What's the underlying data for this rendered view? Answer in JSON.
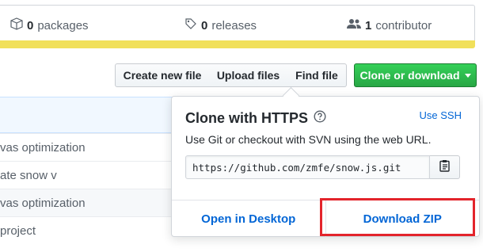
{
  "summary": {
    "packages_count": "0",
    "packages_label": "packages",
    "releases_count": "0",
    "releases_label": "releases",
    "contributors_count": "1",
    "contributors_label": "contributor",
    "language_bar_color": "#f1e05a"
  },
  "toolbar": {
    "create_label": "Create new file",
    "upload_label": "Upload files",
    "find_label": "Find file",
    "clone_label": "Clone or download"
  },
  "files": {
    "commit_messages": [
      "vas optimization",
      "ate snow v",
      "vas optimization",
      "project"
    ]
  },
  "clone": {
    "title": "Clone with HTTPS",
    "use_ssh": "Use SSH",
    "description": "Use Git or checkout with SVN using the web URL.",
    "url": "https://github.com/zmfe/snow.js.git",
    "open_desktop": "Open in Desktop",
    "download_zip": "Download ZIP"
  },
  "colors": {
    "accent": "#0366d6",
    "clone_button": "#28a745",
    "highlight": "#e3242b"
  },
  "icons": [
    "package-icon",
    "tag-icon",
    "people-icon",
    "question-icon",
    "clipboard-icon",
    "caret-down-icon"
  ]
}
